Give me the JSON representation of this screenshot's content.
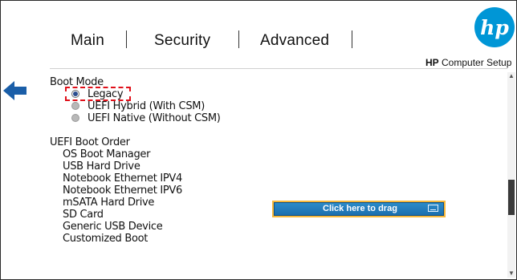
{
  "tabs": [
    {
      "label": "Main"
    },
    {
      "label": "Security"
    },
    {
      "label": "Advanced"
    }
  ],
  "brand": {
    "logo_text": "hp",
    "color": "#0096d6"
  },
  "header": {
    "brand": "HP",
    "title": "Computer Setup"
  },
  "boot_mode": {
    "label": "Boot Mode",
    "options": [
      {
        "label": "Legacy",
        "selected": true
      },
      {
        "label": "UEFI Hybrid (With CSM)",
        "selected": false
      },
      {
        "label": "UEFI Native (Without CSM)",
        "selected": false
      }
    ]
  },
  "uefi_boot_order": {
    "label": "UEFI Boot Order",
    "items": [
      "OS Boot Manager",
      "USB Hard Drive",
      "Notebook Ethernet IPV4",
      "Notebook Ethernet IPV6",
      "mSATA Hard Drive",
      "SD Card",
      "Generic USB Device",
      "Customized Boot"
    ]
  },
  "drag_widget": {
    "label": "Click here to drag"
  },
  "icons": {
    "back": "back-arrow-icon",
    "screen": "screen-icon"
  },
  "colors": {
    "accent": "#1a5ea8",
    "highlight": "#e0101a",
    "drag_bg": "#2a8ac9",
    "drag_border": "#f7b83a"
  }
}
